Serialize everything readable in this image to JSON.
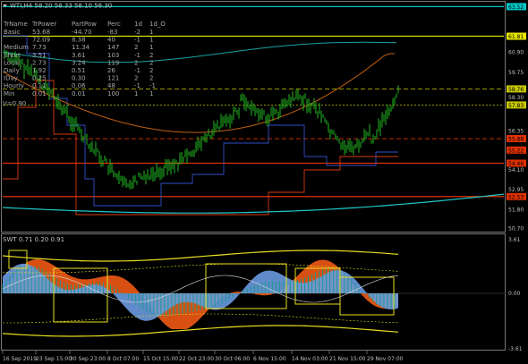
{
  "main_chart": {
    "header": "WTI,H4  58.20 58.33 58.10 58.30",
    "price_labels": [
      {
        "text": "63.52",
        "color": "#00c8c8"
      },
      {
        "text": "61.81",
        "color": "#e8e800"
      },
      {
        "text": "60.90",
        "color": "#000000"
      },
      {
        "text": "59.75",
        "color": "#000000"
      },
      {
        "text": "58.76",
        "color": "#c8c800"
      },
      {
        "text": "58.30",
        "color": "#000000"
      },
      {
        "text": "57.83",
        "color": "#c8c800"
      },
      {
        "text": "56.35",
        "color": "#000000"
      },
      {
        "text": "55.88",
        "color": "#e03000"
      },
      {
        "text": "55.22",
        "color": "#e03000"
      },
      {
        "text": "54.46",
        "color": "#e03000"
      },
      {
        "text": "54.10",
        "color": "#000000"
      },
      {
        "text": "52.95",
        "color": "#000000"
      },
      {
        "text": "52.53",
        "color": "#e03000"
      },
      {
        "text": "51.80",
        "color": "#000000"
      },
      {
        "text": "50.70",
        "color": "#000000"
      }
    ]
  },
  "table": {
    "headers": [
      "TrName",
      "TrPower",
      "PartPow",
      "Perc",
      "1d",
      "1d_O"
    ],
    "rows": [
      [
        "Basic",
        "53.68",
        "-44.70",
        "-83",
        "-2",
        "1"
      ],
      [
        "",
        "72.09",
        "8.38",
        "40",
        "-1",
        "1"
      ],
      [
        "Medium",
        "7.73",
        "11.34",
        "147",
        "2",
        "1"
      ],
      [
        "Short",
        "3.51",
        "3.61",
        "103",
        "-1",
        "2"
      ],
      [
        "Local",
        "2.73",
        "3.24",
        "119",
        "2",
        "2"
      ],
      [
        "Daily",
        "1.92",
        "0.51",
        "26",
        "-1",
        "2"
      ],
      [
        "IDay",
        "0.25",
        "0.30",
        "121",
        "2",
        "2"
      ],
      [
        "Hourly",
        "0.11",
        "0.06",
        "48",
        "-1",
        "-1"
      ],
      [
        "Min",
        "0.01",
        "0.01",
        "100",
        "1",
        "1"
      ]
    ],
    "footer": "V=0.90"
  },
  "sub_chart": {
    "header": "SWT 0.71 0.20 0.91",
    "scale_labels": [
      "3.61",
      "0.00",
      "-3.61"
    ]
  },
  "time_axis": [
    "16 Sep 2019",
    "23 Sep 15:00",
    "30 Sep 23:00",
    "8 Oct 07:00",
    "15 Oct 15:00",
    "22 Oct 23:00",
    "30 Oct 06:00",
    "6 Nov 15:00",
    "14 Nov 03:00",
    "21 Nov 15:00",
    "29 Nov 07:00"
  ]
}
